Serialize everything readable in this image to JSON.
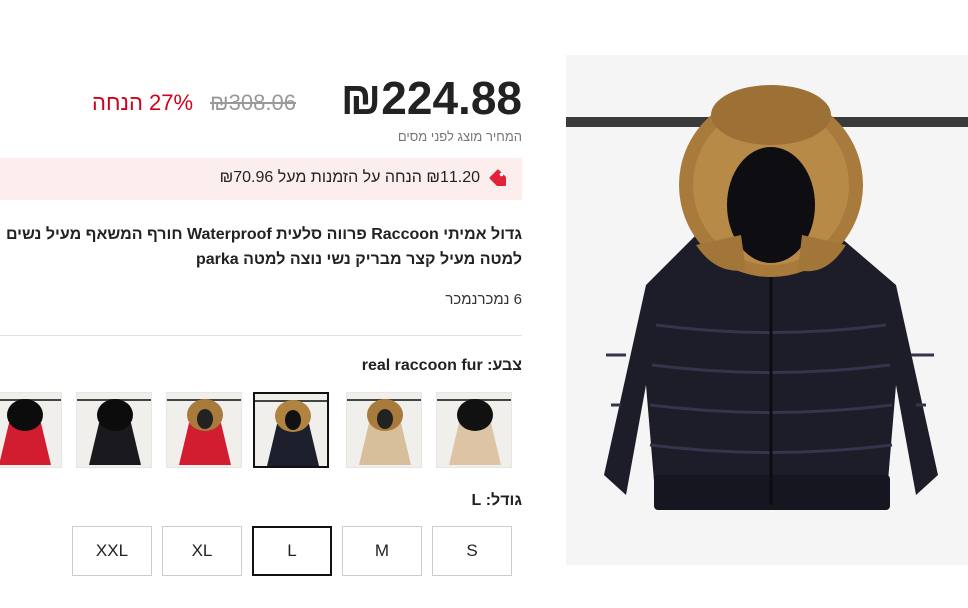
{
  "price": {
    "current": "₪224.88",
    "original": "₪308.06",
    "discount": "27% הנחה",
    "tax_note": "המחיר מוצג לפני מסים"
  },
  "coupon": {
    "text": "₪11.20 הנחה על הזמנות מעל ₪70.96",
    "icon": "tag-icon",
    "icon_color": "#e0233b"
  },
  "product": {
    "title_line1": "גדול אמיתי Raccoon פרווה סלעית Waterproof חורף המשאף מעיל נשים",
    "title_line2": "למטה מעיל קצר מבריק נשי נוצה למטה parka",
    "sold": "6 נמכרנמכר"
  },
  "color": {
    "label": "צבע: real raccoon fur",
    "swatches": [
      {
        "name": "beige-black-fur",
        "selected": false
      },
      {
        "name": "beige-raccoon-fur",
        "selected": false
      },
      {
        "name": "navy-raccoon-fur",
        "selected": true
      },
      {
        "name": "red-raccoon-fur",
        "selected": false
      },
      {
        "name": "black-black-fur",
        "selected": false
      },
      {
        "name": "red-black-fur",
        "selected": false
      }
    ]
  },
  "size": {
    "label": "גודל: L",
    "options": [
      "S",
      "M",
      "L",
      "XL",
      "XXL"
    ],
    "selected": "L"
  },
  "colors": {
    "accent": "#d0021b",
    "coupon_bg": "#fdeeee",
    "selected_border": "#111111"
  }
}
